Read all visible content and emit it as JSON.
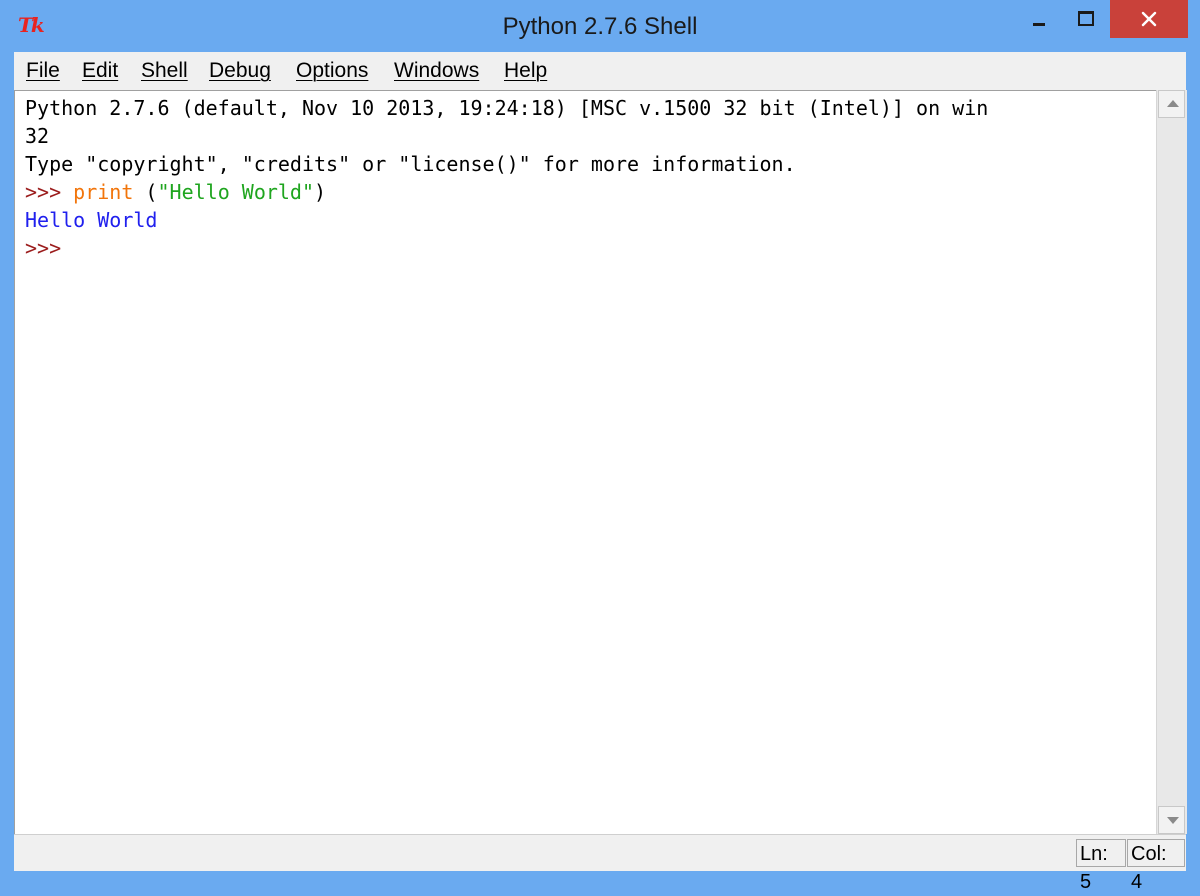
{
  "window": {
    "title": "Python 2.7.6 Shell",
    "icon_text": "Tk",
    "colors": {
      "frame": "#6aaaf0",
      "close": "#c9413a",
      "menu_bg": "#f0f0f0"
    }
  },
  "menu": {
    "items": [
      {
        "label": "File"
      },
      {
        "label": "Edit"
      },
      {
        "label": "Shell"
      },
      {
        "label": "Debug"
      },
      {
        "label": "Options"
      },
      {
        "label": "Windows"
      },
      {
        "label": "Help"
      }
    ]
  },
  "shell": {
    "banner_line1": "Python 2.7.6 (default, Nov 10 2013, 19:24:18) [MSC v.1500 32 bit (Intel)] on win",
    "banner_line2": "32",
    "banner_line3": "Type \"copyright\", \"credits\" or \"license()\" for more information.",
    "prompt": ">>> ",
    "command_keyword": "print",
    "command_open": " (",
    "command_string": "\"Hello World\"",
    "command_close": ")",
    "output": "Hello World",
    "final_prompt": ">>>",
    "colors": {
      "prompt": "#9b1c1c",
      "keyword": "#f2750b",
      "string": "#1fa51f",
      "output": "#2020ee"
    }
  },
  "status": {
    "ln": "Ln: 5",
    "col": "Col: 4"
  }
}
